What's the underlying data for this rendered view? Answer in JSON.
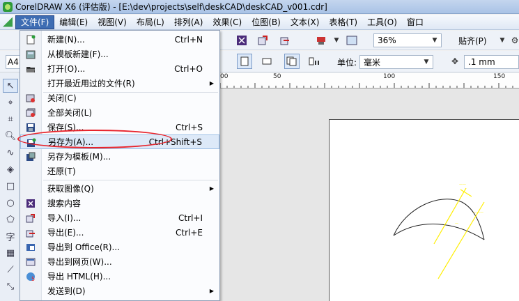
{
  "window": {
    "title": "CorelDRAW X6 (评估版) - [E:\\dev\\projects\\self\\deskCAD\\deskCAD_v001.cdr]"
  },
  "menubar": {
    "items": [
      "文件(F)",
      "编辑(E)",
      "视图(V)",
      "布局(L)",
      "排列(A)",
      "效果(C)",
      "位图(B)",
      "文本(X)",
      "表格(T)",
      "工具(O)",
      "窗口"
    ]
  },
  "toolbar": {
    "zoom": "36%",
    "snap": "贴齐(P)",
    "page_size": "A4",
    "units_label": "单位:",
    "units": "毫米",
    "nudge": ".1 mm"
  },
  "ruler": {
    "labels": [
      "00",
      "50",
      "100",
      "150"
    ]
  },
  "file_menu": {
    "items": [
      {
        "label": "新建(N)...",
        "shortcut": "Ctrl+N",
        "icon": "new-document-icon"
      },
      {
        "label": "从模板新建(F)...",
        "shortcut": "",
        "icon": "new-from-template-icon"
      },
      {
        "label": "打开(O)...",
        "shortcut": "Ctrl+O",
        "icon": "open-folder-icon"
      },
      {
        "label": "打开最近用过的文件(R)",
        "shortcut": "",
        "icon": "",
        "submenu": true
      },
      {
        "label": "关闭(C)",
        "shortcut": "",
        "icon": "close-document-icon"
      },
      {
        "label": "全部关闭(L)",
        "shortcut": "",
        "icon": "close-all-icon"
      },
      {
        "label": "保存(S)...",
        "shortcut": "Ctrl+S",
        "icon": "save-icon"
      },
      {
        "label": "另存为(A)...",
        "shortcut": "Ctrl+Shift+S",
        "icon": "save-as-icon",
        "highlighted": true
      },
      {
        "label": "另存为模板(M)...",
        "shortcut": "",
        "icon": "save-as-template-icon"
      },
      {
        "label": "还原(T)",
        "shortcut": "",
        "icon": "revert-icon"
      },
      {
        "label": "获取图像(Q)",
        "shortcut": "",
        "icon": "",
        "submenu": true
      },
      {
        "label": "搜索内容",
        "shortcut": "",
        "icon": "search-content-icon"
      },
      {
        "label": "导入(I)...",
        "shortcut": "Ctrl+I",
        "icon": "import-icon"
      },
      {
        "label": "导出(E)...",
        "shortcut": "Ctrl+E",
        "icon": "export-icon"
      },
      {
        "label": "导出到 Office(R)...",
        "shortcut": "",
        "icon": "export-office-icon"
      },
      {
        "label": "导出到网页(W)...",
        "shortcut": "",
        "icon": "export-web-icon"
      },
      {
        "label": "导出 HTML(H)...",
        "shortcut": "",
        "icon": "export-html-icon"
      },
      {
        "label": "发送到(D)",
        "shortcut": "",
        "icon": "",
        "submenu": true
      }
    ]
  },
  "colors": {
    "highlight_ellipse": "#e8232b",
    "menu_active": "#3e6db3",
    "dimension_lines": "#ffee00"
  }
}
